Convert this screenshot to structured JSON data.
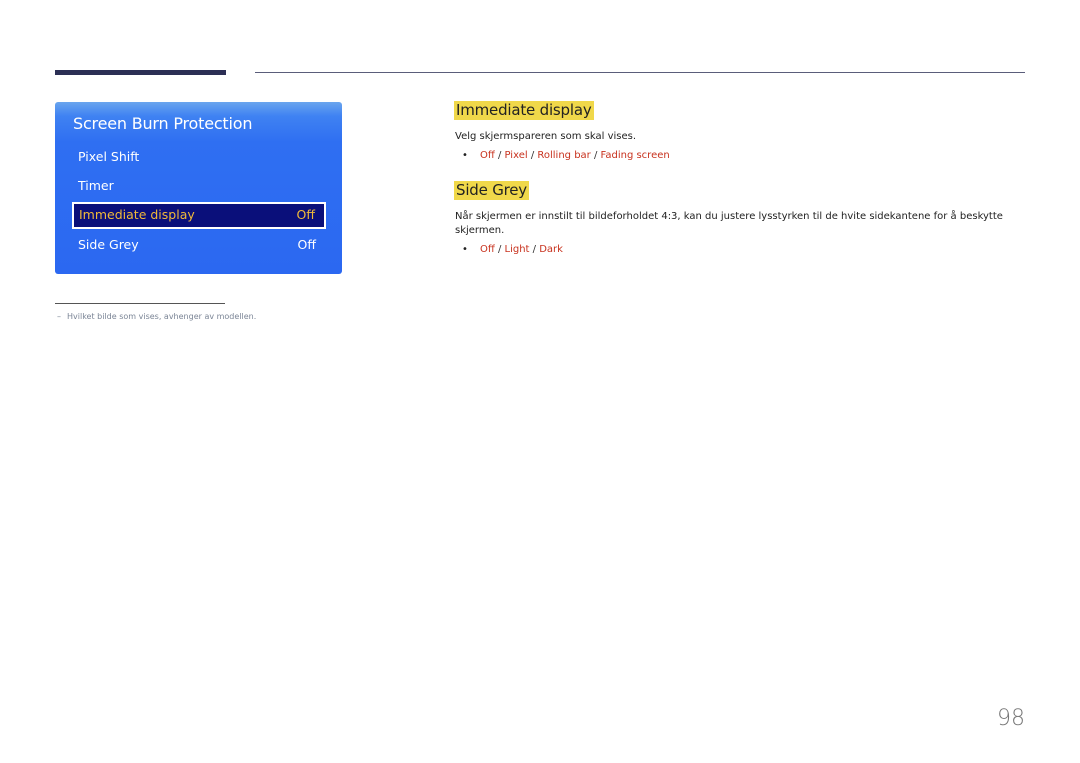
{
  "osd_menu": {
    "title": "Screen Burn Protection",
    "items": [
      {
        "label": "Pixel Shift",
        "value": ""
      },
      {
        "label": "Timer",
        "value": ""
      },
      {
        "label": "Immediate display",
        "value": "Off",
        "selected": true
      },
      {
        "label": "Side Grey",
        "value": "Off"
      }
    ]
  },
  "sections": [
    {
      "heading": "Immediate display",
      "description": "Velg skjermspareren som skal vises.",
      "options": [
        "Off",
        "Pixel",
        "Rolling bar",
        "Fading screen"
      ]
    },
    {
      "heading": "Side Grey",
      "description": "Når skjermen er innstilt til bildeforholdet 4:3, kan du justere lysstyrken til de hvite sidekantene for å beskytte skjermen.",
      "options": [
        "Off",
        "Light",
        "Dark"
      ]
    }
  ],
  "footnote": {
    "dash": "–",
    "text": "Hvilket bilde som vises, avhenger av modellen."
  },
  "option_separator": " / ",
  "bullet": "•",
  "page_number": "98",
  "colors": {
    "highlight": "#f0d84a",
    "option_text": "#c8321e",
    "osd_background": "#2b68f1",
    "osd_selected": "#0a0f7a",
    "osd_selected_text": "#f0b93a"
  }
}
